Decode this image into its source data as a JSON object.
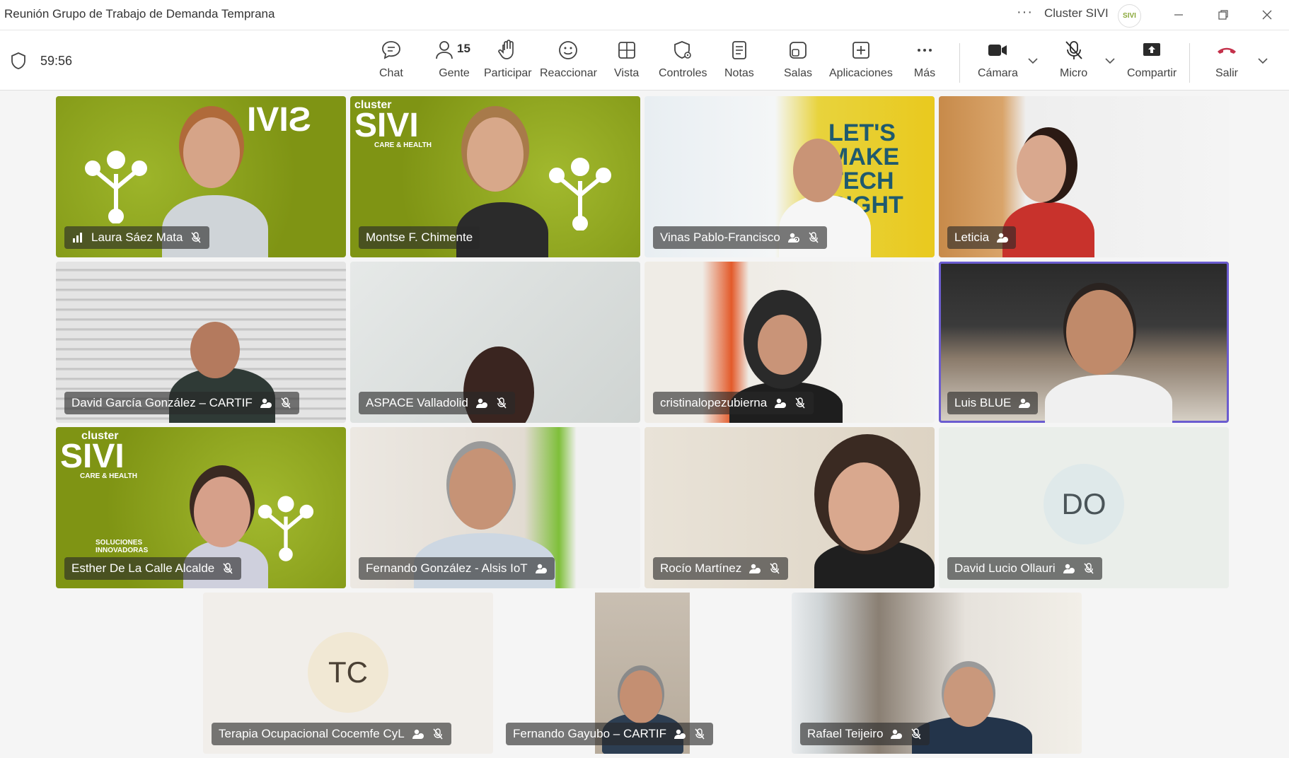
{
  "window": {
    "title": "Reunión Grupo de Trabajo de Demanda Temprana",
    "more": "···",
    "org_name": "Cluster SIVI",
    "org_logo_text": "SIVI"
  },
  "toolbar": {
    "timer": "59:56",
    "buttons": [
      {
        "label": "Chat",
        "icon": "chat-icon"
      },
      {
        "label": "Gente",
        "icon": "people-icon",
        "count": "15"
      },
      {
        "label": "Participar",
        "icon": "raise-hand-icon"
      },
      {
        "label": "Reaccionar",
        "icon": "smiley-icon"
      },
      {
        "label": "Vista",
        "icon": "grid-view-icon"
      },
      {
        "label": "Controles",
        "icon": "shield-settings-icon"
      },
      {
        "label": "Notas",
        "icon": "notes-icon"
      },
      {
        "label": "Salas",
        "icon": "rooms-icon"
      },
      {
        "label": "Aplicaciones",
        "icon": "add-apps-icon"
      },
      {
        "label": "Más",
        "icon": "more-icon"
      },
      {
        "label": "Cámara",
        "icon": "camera-icon"
      },
      {
        "label": "Micro",
        "icon": "mic-off-icon"
      },
      {
        "label": "Compartir",
        "icon": "share-icon"
      },
      {
        "label": "Salir",
        "icon": "hang-up-icon"
      }
    ]
  },
  "participants": [
    {
      "name": "Laura Sáez Mata",
      "signal": true,
      "muted": true,
      "spotlight": false
    },
    {
      "name": "Montse F. Chimente",
      "muted": false
    },
    {
      "name": "Vinas Pablo-Francisco",
      "external": true,
      "muted": true
    },
    {
      "name": "Leticia",
      "external": true,
      "muted": false
    },
    {
      "name": "David García González – CARTIF",
      "external": true,
      "muted": true
    },
    {
      "name": "ASPACE Valladolid",
      "external": true,
      "muted": true
    },
    {
      "name": "cristinalopezubierna",
      "external": true,
      "muted": true
    },
    {
      "name": "Luis BLUE",
      "external": true,
      "muted": false,
      "active": true
    },
    {
      "name": "Esther De La Calle Alcalde",
      "muted": true
    },
    {
      "name": "Fernando González - Alsis IoT",
      "external": true,
      "muted": false
    },
    {
      "name": "Rocío Martínez",
      "external": true,
      "muted": true
    },
    {
      "name": "David Lucio Ollauri",
      "external": true,
      "muted": true,
      "initials": "DO"
    },
    {
      "name": "Terapia Ocupacional Cocemfe CyL",
      "external": true,
      "muted": true,
      "initials": "TC"
    },
    {
      "name": "Fernando Gayubo – CARTIF",
      "external": true,
      "muted": true
    },
    {
      "name": "Rafael Teijeiro",
      "external": true,
      "muted": true
    }
  ],
  "backgrounds": {
    "sivi_logo_top": "cluster",
    "sivi_logo_main": "SIVI",
    "sivi_logo_sub": "CARE & HEALTH",
    "sivi_slogan": "SOLUCIONES INNOVADORAS",
    "wall_text": "LET'S MAKE TECH RIGHT"
  },
  "colors": {
    "active_speaker": "#6b5ccf",
    "sivi_green": "#8aa020",
    "hangup_red": "#c4314b"
  }
}
